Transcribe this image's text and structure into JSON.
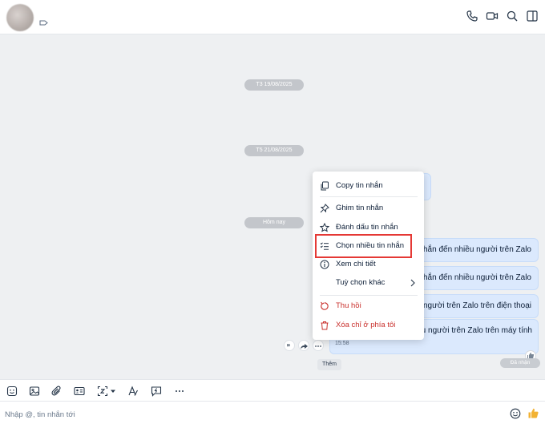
{
  "dates": {
    "d1": "T3 19/08/2025",
    "d2": "T5 21/08/2025",
    "d3": "Hôm nay"
  },
  "messages": [
    "nhắn đến nhiều người trên Zalo",
    "nhắn đến nhiều người trên Zalo",
    "người trên Zalo trên điện thoại",
    "u người trên Zalo trên máy tính"
  ],
  "last_message_time": "15:58",
  "seen_label": "Đã nhận",
  "context_menu": {
    "copy": "Copy tin nhắn",
    "pin": "Ghim tin nhắn",
    "star": "Đánh dấu tin nhắn",
    "select_multiple": "Chọn nhiều tin nhắn",
    "details": "Xem chi tiết",
    "more_options": "Tuỳ chọn khác",
    "recall": "Thu hồi",
    "delete_for_me": "Xóa chỉ ở phía tôi"
  },
  "tooltip_more": "Thêm",
  "composer": {
    "placeholder": "Nhập @, tin nhắn tới"
  },
  "colors": {
    "accent": "#0068ff",
    "danger": "#c9302c",
    "highlight": "#e53935",
    "bubble": "#dbe9fd"
  }
}
